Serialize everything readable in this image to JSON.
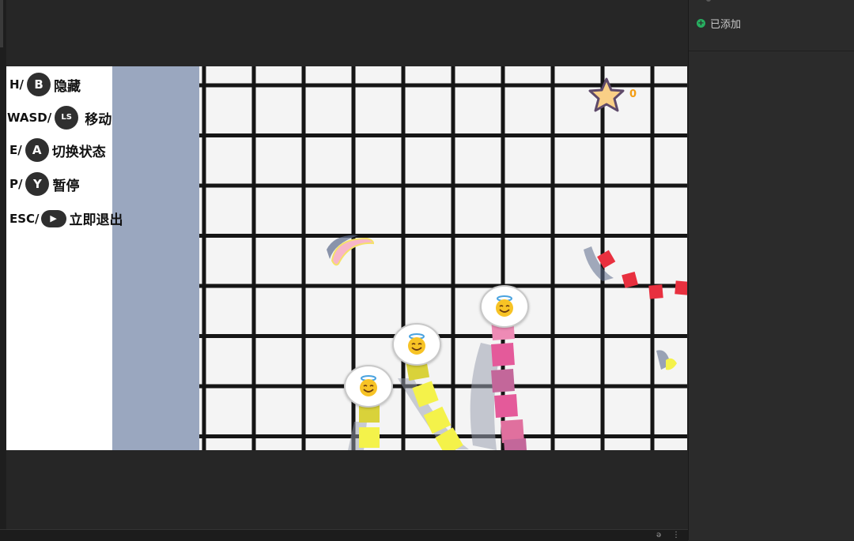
{
  "panel": {
    "added_label": "已添加",
    "added_icon": "plus-circle-icon"
  },
  "controls": [
    {
      "key": "H/",
      "button": "B",
      "label": "隐藏"
    },
    {
      "key": "WASD/",
      "button": "LS",
      "label": "移动"
    },
    {
      "key": "E/",
      "button": "A",
      "label": "切换状态"
    },
    {
      "key": "P/",
      "button": "Y",
      "label": "暂停"
    },
    {
      "key": "ESC/",
      "button": "▶",
      "label": "立即退出"
    }
  ],
  "hud": {
    "score": "0",
    "star_icon": "star-icon"
  },
  "players": [
    {
      "color": "#f4f24a",
      "face_icon": "smiling-face-with-halo-icon"
    },
    {
      "color": "#f4f24a",
      "face_icon": "smiling-face-with-halo-icon"
    },
    {
      "color": "#e45a9a",
      "face_icon": "smiling-face-with-halo-icon"
    }
  ],
  "colors": {
    "background": "#262626",
    "game_floor": "#f4f4f4",
    "grid_lines": "#151515",
    "blue_band": "#9aa7bf",
    "red_snake": "#e8303f",
    "yellow_snake": "#f4f24a",
    "pink_snake": "#e45a9a",
    "accent_green": "#27ae60",
    "score_orange": "#f39c12"
  }
}
